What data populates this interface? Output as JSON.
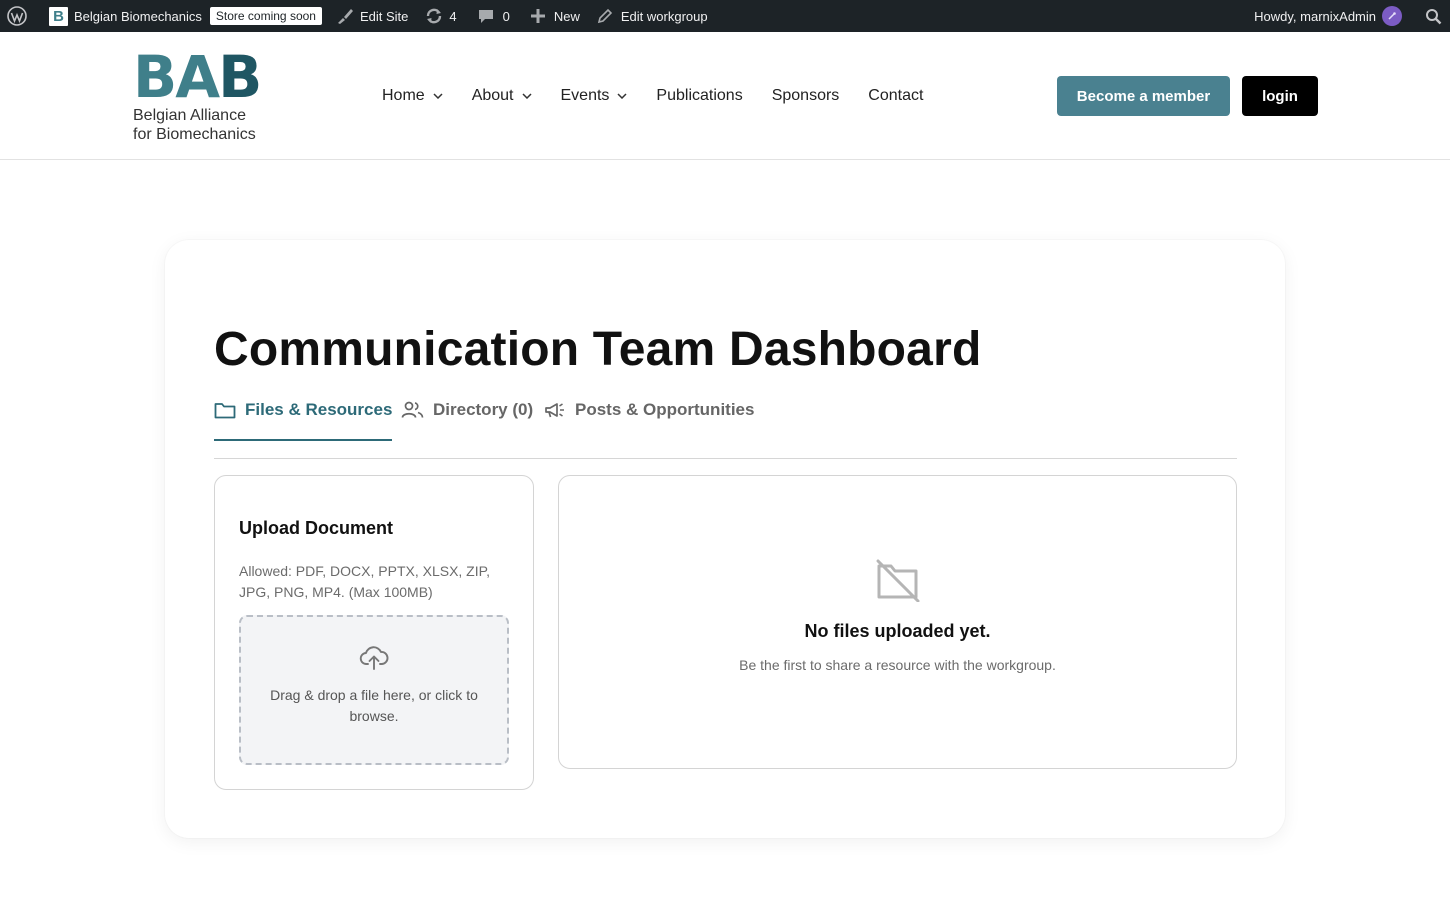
{
  "adminbar": {
    "site_name": "Belgian Biomechanics",
    "store_badge": "Store coming soon",
    "edit_site": "Edit Site",
    "updates_count": "4",
    "comments_count": "0",
    "new_label": "New",
    "edit_workgroup": "Edit workgroup",
    "howdy": "Howdy, marnixAdmin"
  },
  "header": {
    "logo_letters": "BAB",
    "logo_line1": "Belgian Alliance",
    "logo_line2": "for Biomechanics",
    "nav": [
      {
        "label": "Home",
        "has_dropdown": true
      },
      {
        "label": "About",
        "has_dropdown": true
      },
      {
        "label": "Events",
        "has_dropdown": true
      },
      {
        "label": "Publications",
        "has_dropdown": false
      },
      {
        "label": "Sponsors",
        "has_dropdown": false
      },
      {
        "label": "Contact",
        "has_dropdown": false
      }
    ],
    "member_button": "Become a member",
    "login_button": "login"
  },
  "dashboard": {
    "title": "Communication Team Dashboard",
    "tabs": [
      {
        "label": "Files & Resources",
        "icon": "folder-icon",
        "active": true
      },
      {
        "label": "Directory (0)",
        "icon": "users-icon",
        "active": false
      },
      {
        "label": "Posts & Opportunities",
        "icon": "megaphone-icon",
        "active": false
      }
    ],
    "upload": {
      "title": "Upload Document",
      "allowed": "Allowed: PDF, DOCX, PPTX, XLSX, ZIP, JPG, PNG, MP4. (Max 100MB)",
      "dropzone_text": "Drag & drop a file here, or click to browse."
    },
    "files": {
      "empty_title": "No files uploaded yet.",
      "empty_subtitle": "Be the first to share a resource with the workgroup."
    }
  },
  "colors": {
    "admin_bar": "#1d2327",
    "accent_teal": "#2d6a78",
    "member_button": "#4a8190",
    "login_button": "#000000"
  }
}
